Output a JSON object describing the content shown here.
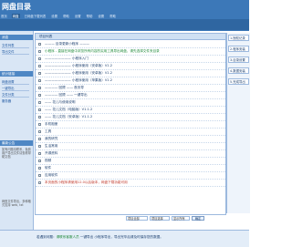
{
  "header": {
    "logo": "网盘目录",
    "nav": [
      "首页",
      "网盘",
      "已网盘下载列表",
      "设置",
      "帮助",
      "设置",
      "帮助",
      "设置",
      "帮助"
    ]
  },
  "sidebar": {
    "head1": "消息",
    "links1": [
      "文件列表",
      "导出文件"
    ],
    "head2": "统计链接",
    "links2": [
      "网盘设置",
      "一键导出",
      "文件分类",
      "服务器"
    ],
    "notice_title": "最新公告",
    "notice": "如有问题请联系，免费用户导出文件请查看帮助文档",
    "notice2": "网盘文件导出，多种格式支持 web, txt",
    "btn": "网盘设置"
  },
  "center": {
    "header": "项目列表",
    "rows": [
      {
        "text": "——— 目录更新小程序 ———",
        "color": "normal"
      },
      {
        "text": "小程序 - 直接在网盘中浏览所有内容的实用工具导出网盘，请先选择文件夹目录",
        "color": "green"
      },
      {
        "text": "———————— 小程序入门",
        "color": "normal"
      },
      {
        "text": "———————— 小程序使用（安卓版）V1.2",
        "color": "normal"
      },
      {
        "text": "———————— 小程序使用（安卓版）V1.2",
        "color": "normal"
      },
      {
        "text": "———————— 小程序使用（苹果版）V1.2",
        "color": "normal"
      },
      {
        "text": "———— 回顾 —— 首页导",
        "color": "normal"
      },
      {
        "text": "———— 回顾 —— 一键导出",
        "color": "normal"
      },
      {
        "text": "—— 花儿与使用说明",
        "color": "normal"
      },
      {
        "text": "—— 花儿文档（电脑版）V1.1.2",
        "color": "normal"
      },
      {
        "text": "—— 花儿文档（安卓版）V1.1.2",
        "color": "normal"
      },
      {
        "text": "手机相册",
        "color": "normal"
      },
      {
        "text": "工具",
        "color": "normal"
      },
      {
        "text": "我的研究",
        "color": "normal"
      },
      {
        "text": "生活常用",
        "color": "normal"
      },
      {
        "text": "开源资料",
        "color": "normal"
      },
      {
        "text": "视频",
        "color": "normal"
      },
      {
        "text": "软件",
        "color": "normal"
      },
      {
        "text": "应用软件",
        "color": "normal"
      },
      {
        "text": "本页面的小程序请使用12.0以后版本，网盘下载功能可用",
        "color": "red"
      }
    ]
  },
  "statusbar": {
    "select1": "项目全部",
    "select2": "项目选择",
    "select3": "显示所有",
    "btn": "确定"
  },
  "right": {
    "items": [
      "1.授权记录",
      "2.程序安装",
      "3.目录设置",
      "4.数据安装",
      "5.完成导出"
    ]
  },
  "footer": {
    "text_a": "若遇到问题：",
    "text_em": "请联系客服人员",
    "text_b": " 一键导出 小程序导出，导出完毕后请及时保存您的数据。"
  }
}
